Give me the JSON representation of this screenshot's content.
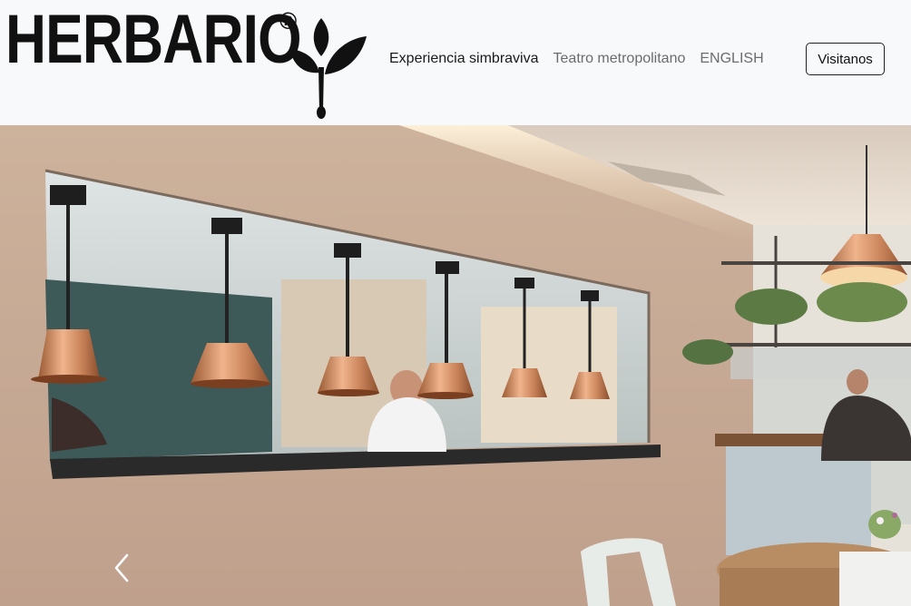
{
  "brand": {
    "name": "HERBARIO",
    "registered_mark": "®"
  },
  "nav": {
    "links": [
      {
        "label": "Experiencia simbraviva",
        "active": true
      },
      {
        "label": "Teatro metropolitano",
        "active": false
      },
      {
        "label": "ENGLISH",
        "active": false
      }
    ],
    "cta_label": "Visitanos"
  },
  "hero": {
    "image_description": "restaurant-kitchen-pass-photo",
    "carousel_control": "chevron-left-icon"
  },
  "colors": {
    "navbar_bg": "#f8f9fa",
    "text_dark": "#111111",
    "text_muted": "#6c6c6c",
    "copper": "#c9835a",
    "wall": "#c5a895"
  }
}
